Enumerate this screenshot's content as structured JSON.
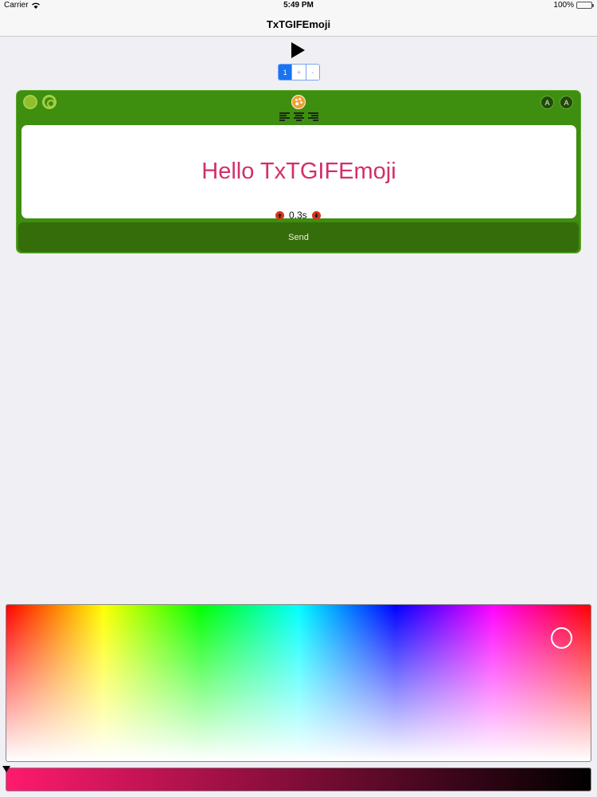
{
  "status_bar": {
    "carrier": "Carrier",
    "time": "5:49 PM",
    "battery": "100%"
  },
  "nav": {
    "title": "TxTGIFEmoji"
  },
  "frame_stepper": {
    "current": "1",
    "plus": "+",
    "minus": "-"
  },
  "editor": {
    "text": "Hello TxTGIFEmoji",
    "text_color": "#d22f6a",
    "background_color": "#3e8e10",
    "duration": "0.3s",
    "send_label": "Send"
  },
  "icons": {
    "play": "play-icon",
    "palette": "palette-icon",
    "font_up": "font-size-increase-icon",
    "font_down": "font-size-decrease-icon"
  },
  "color_picker": {
    "selected_color": "#ff1a6e"
  }
}
